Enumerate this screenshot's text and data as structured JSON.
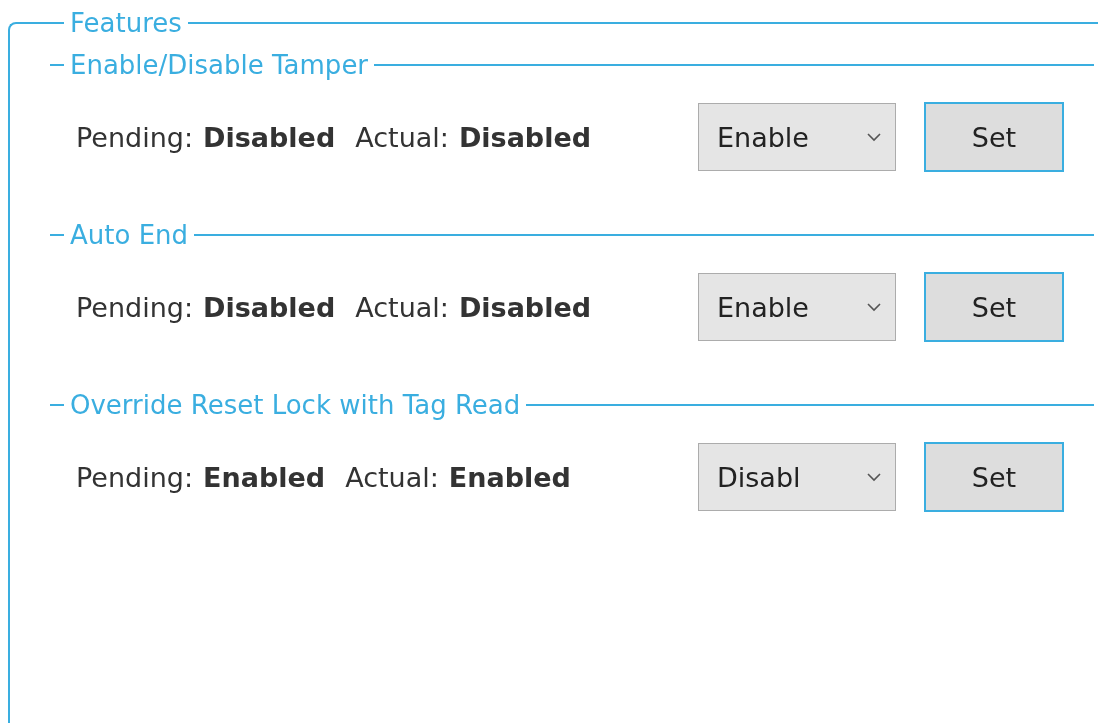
{
  "features": {
    "title": "Features",
    "sections": [
      {
        "title": "Enable/Disable Tamper",
        "pending_label": "Pending:",
        "pending_value": "Disabled",
        "actual_label": "Actual:",
        "actual_value": "Disabled",
        "dropdown": "Enable",
        "button": "Set"
      },
      {
        "title": "Auto End",
        "pending_label": "Pending:",
        "pending_value": "Disabled",
        "actual_label": "Actual:",
        "actual_value": "Disabled",
        "dropdown": "Enable",
        "button": "Set"
      },
      {
        "title": "Override Reset Lock with Tag Read",
        "pending_label": "Pending:",
        "pending_value": "Enabled",
        "actual_label": "Actual:",
        "actual_value": "Enabled",
        "dropdown": "Disabl",
        "button": "Set"
      }
    ]
  }
}
